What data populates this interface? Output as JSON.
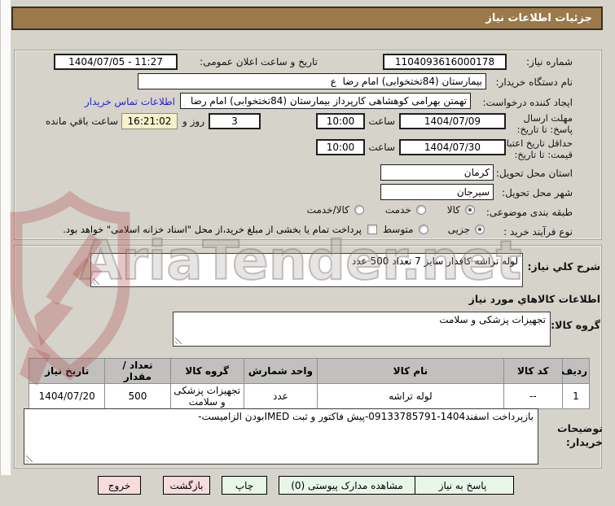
{
  "title": "جزئیات اطلاعات نیاز",
  "watermark": {
    "text": "AriaTender.net"
  },
  "fields": {
    "need_no_label": "شماره نیاز:",
    "need_no": "1104093616000178",
    "announce_label": "تاریخ و ساعت اعلان عمومی:",
    "announce": "1404/07/05 - 11:27",
    "buyer_org_label": "نام دستگاه خریدار:",
    "buyer_org": "بیمارستان (84تختخوابی) امام رضا  ع",
    "creator_label": "ایجاد کننده درخواست:",
    "creator": "تهمتن بهرامی کوهشاهی کارپرداز بیمارستان (84تختخوابی) امام رضا  ع",
    "contact_link": "اطلاعات تماس خریدار",
    "deadline_label": "مهلت ارسال پاسخ: تا تاریخ:",
    "deadline_date": "1404/07/09",
    "hour_label": "ساعت",
    "deadline_time": "10:00",
    "days_left": "3",
    "days_and_label": "روز و",
    "time_left": "16:21:02",
    "hours_left_label": "ساعت باقي مانده",
    "validity_label": "حداقل تاریخ اعتبار قیمت: تا تاریخ:",
    "validity_date": "1404/07/30",
    "validity_time": "10:00",
    "province_label": "استان محل تحویل:",
    "province": "کرمان",
    "city_label": "شهر محل تحویل:",
    "city": "سیرجان",
    "class_label": "طبقه بندی موضوعی:",
    "class_options": [
      "کالا",
      "خدمت",
      "کالا/خدمت"
    ],
    "process_label": "نوع فرآیند خرید :",
    "process_options": [
      "جزیی",
      "متوسط"
    ],
    "treasury_checkbox": "پرداخت تمام یا بخشی از مبلغ خرید،از محل \"اسناد خزانه اسلامی\" خواهد بود."
  },
  "need_desc": {
    "label": "شرح کلي نیاز:",
    "value": "لوله تراشه کافدار سایز 7 تعداد 500 عدد"
  },
  "goods_section": {
    "heading": "اطلاعات کالاهاي مورد نیاز",
    "group_label": "گروه کالا:",
    "group_value": "تجهیزات پزشکی و سلامت"
  },
  "table": {
    "headers": [
      "ردیف",
      "کد کالا",
      "نام کالا",
      "واحد شمارش",
      "گروه کالا",
      "تعداد / مقدار",
      "تاریخ نیاز"
    ],
    "rows": [
      [
        "1",
        "--",
        "لوله تراشه",
        "عدد",
        "تجهیزات پزشکی و سلامت",
        "500",
        "1404/07/20"
      ]
    ]
  },
  "buyer_notes": {
    "label": "توضیحات خریدار:",
    "value": "بازپرداخت اسفند1404-09133785791-پیش فاکتور و ثبت IMEDبودن الزامیست-"
  },
  "buttons": {
    "respond": "پاسخ به نیاز",
    "view_docs": "مشاهده مدارک پیوستی (0)",
    "print": "چاپ",
    "back": "بازگشت",
    "exit": "خروج"
  }
}
